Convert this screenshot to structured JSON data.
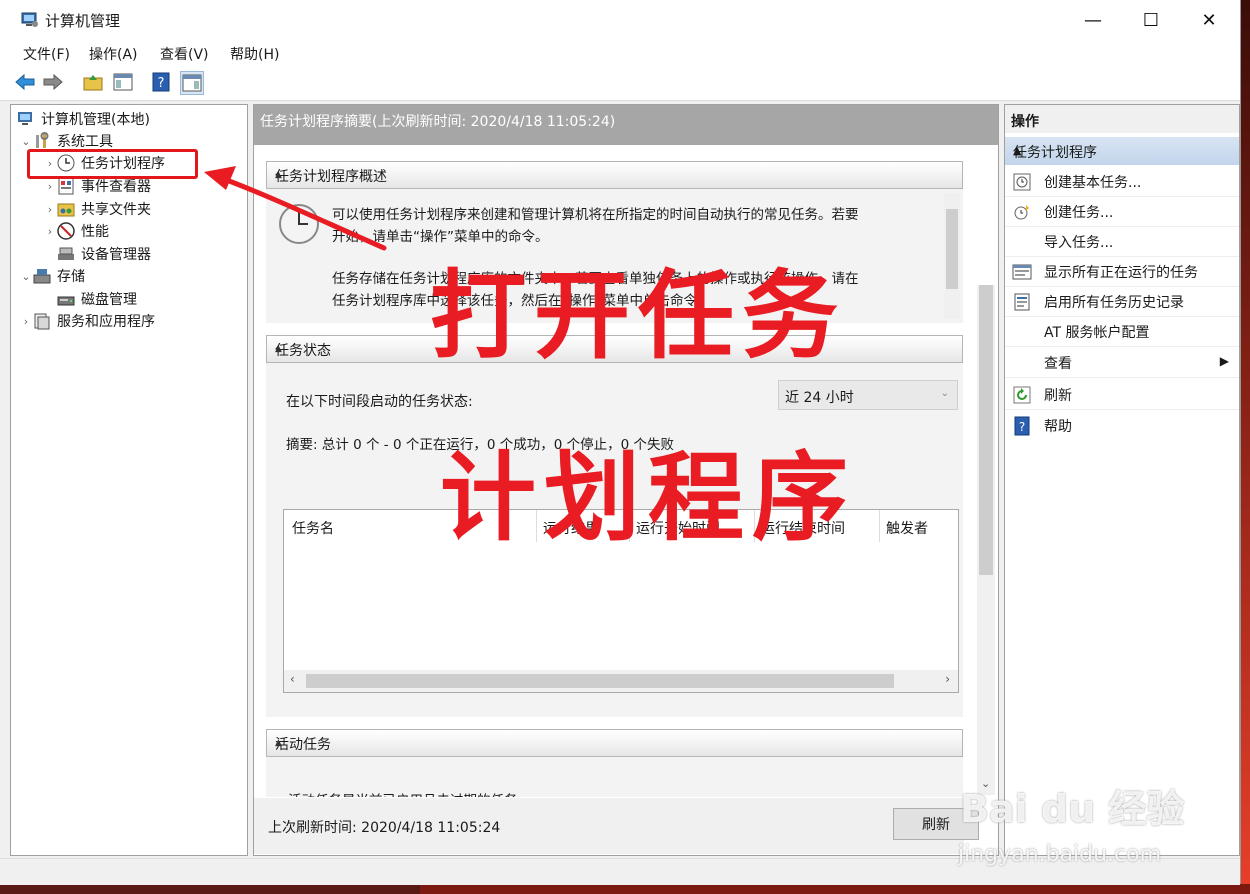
{
  "window": {
    "title": "计算机管理",
    "minimize": "—",
    "maximize": "☐",
    "close": "✕"
  },
  "menu": [
    "文件(F)",
    "操作(A)",
    "查看(V)",
    "帮助(H)"
  ],
  "tree": {
    "root": "计算机管理(本地)",
    "system_tools": "系统工具",
    "task_scheduler": "任务计划程序",
    "event_viewer": "事件查看器",
    "shared_folders": "共享文件夹",
    "performance": "性能",
    "device_manager": "设备管理器",
    "storage": "存储",
    "disk_management": "磁盘管理",
    "services_apps": "服务和应用程序"
  },
  "center": {
    "header": "任务计划程序摘要(上次刷新时间: 2020/4/18 11:05:24)",
    "overview": {
      "title": "任务计划程序概述",
      "line1": "可以使用任务计划程序来创建和管理计算机将在所指定的时间自动执行的常见任务。若要",
      "line2": "开始，请单击“操作”菜单中的命令。",
      "line3": "任务存储在任务计划程序库的文件夹中。若要查看单独任务上的操作或执行该操作，请在",
      "line4": "任务计划程序库中选择该任务，然后在“操作”菜单中单击命令。"
    },
    "status": {
      "title": "任务状态",
      "period_label": "在以下时间段启动的任务状态:",
      "period_value": "近 24 小时",
      "summary": "摘要: 总计 0 个 - 0 个正在运行，0 个成功，0 个停止，0 个失败",
      "columns": [
        "任务名",
        "运行结果",
        "运行开始时间",
        "运行结束时间",
        "触发者"
      ]
    },
    "active": {
      "title": "活动任务",
      "text": "活动任务是当前已启用且未过期的任务。"
    },
    "last_refresh": "上次刷新时间: 2020/4/18 11:05:24",
    "refresh_button": "刷新"
  },
  "actions": {
    "title": "操作",
    "group": "任务计划程序",
    "items": [
      "创建基本任务...",
      "创建任务...",
      "导入任务...",
      "显示所有正在运行的任务",
      "启用所有任务历史记录",
      "AT 服务帐户配置",
      "查看",
      "刷新",
      "帮助"
    ]
  },
  "annotation": {
    "line1": "打开任务",
    "line2": "计划程序"
  },
  "watermark": {
    "brand": "Bai du 经验",
    "url": "jingyan.baidu.com"
  }
}
